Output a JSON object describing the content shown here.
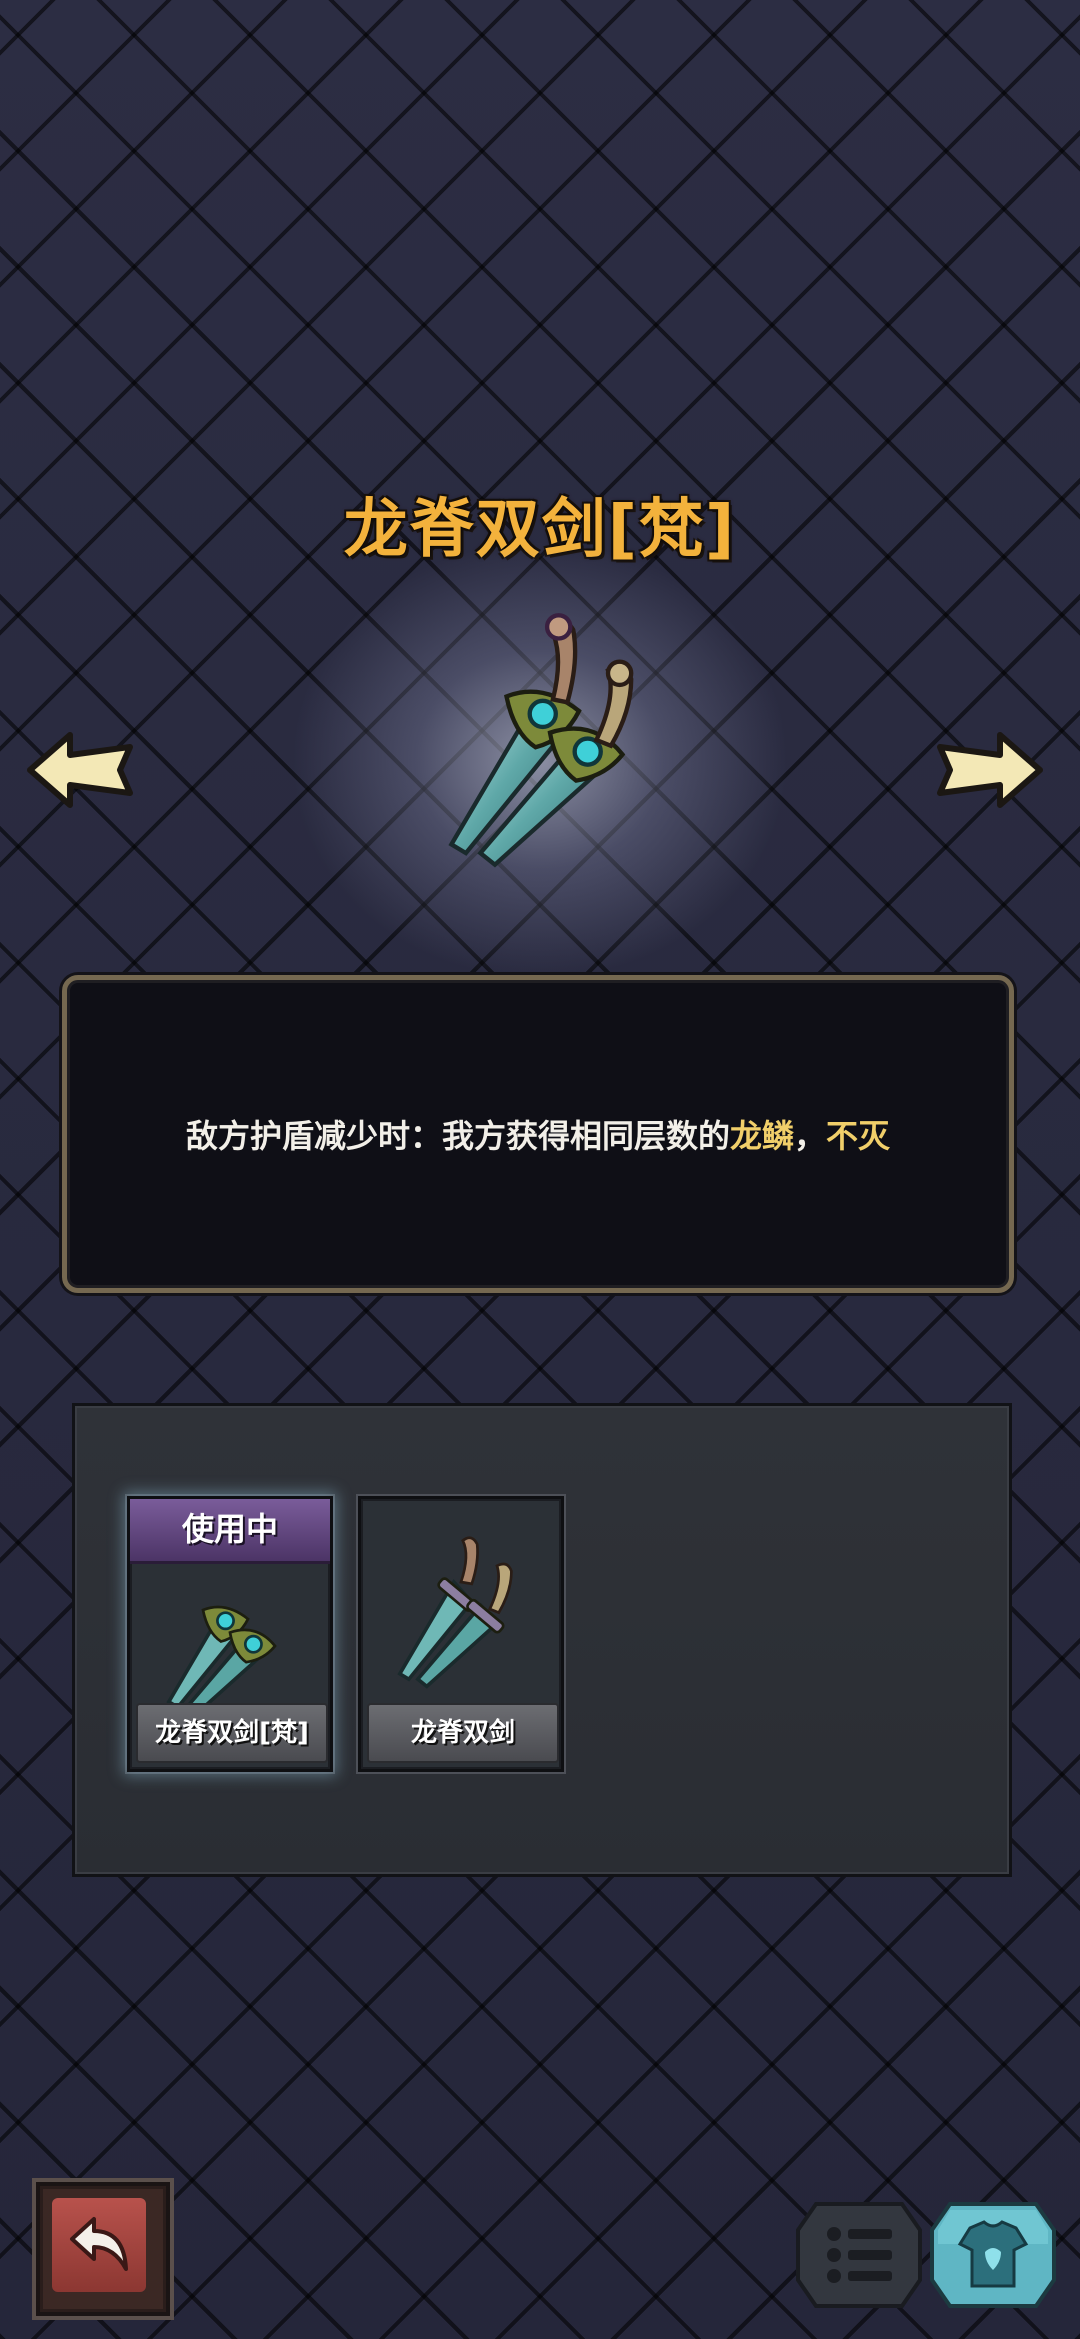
{
  "weapon": {
    "title": "龙脊双剑[梵]",
    "description_main": "敌方护盾减少时：我方获得相同层数的",
    "description_keyword1": "龙鳞",
    "description_sep": "，",
    "description_keyword2": "不灭"
  },
  "inventory": {
    "items": [
      {
        "banner": "使用中",
        "name": "龙脊双剑[梵]",
        "selected": true
      },
      {
        "name": "龙脊双剑",
        "selected": false
      }
    ]
  },
  "controls": {
    "prev_icon": "arrow-left-icon",
    "next_icon": "arrow-right-icon",
    "back_icon": "return-arrow-icon",
    "list_icon": "list-icon",
    "outfit_icon": "shirt-icon"
  },
  "colors": {
    "title": "#f3b23c",
    "keyword": "#f1cf6a",
    "in_use_banner": "#6a4d8a"
  }
}
